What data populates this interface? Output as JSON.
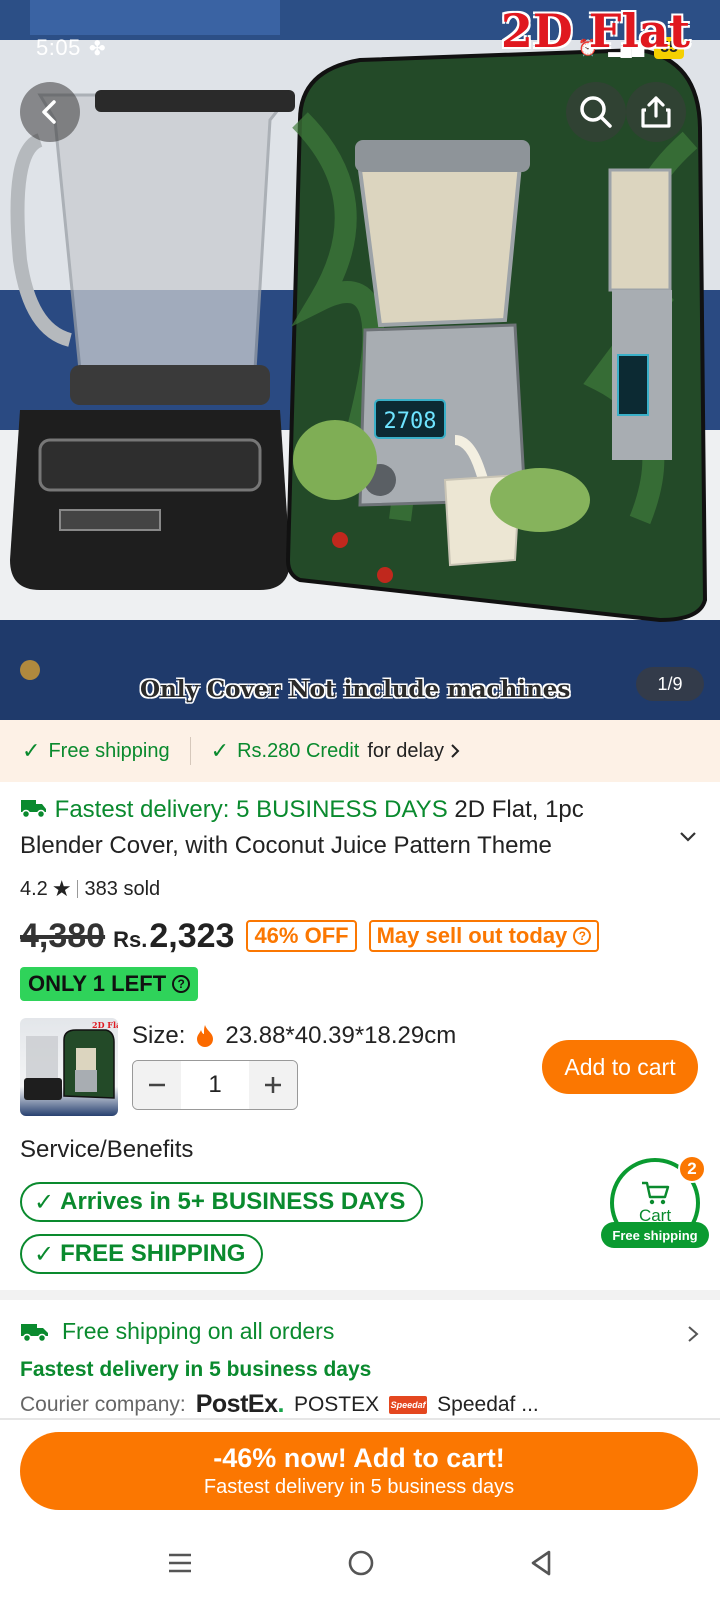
{
  "status_bar": {
    "time": "5:05",
    "battery": "55"
  },
  "hero": {
    "brand_mark": "2D Flat",
    "caption": "Only Cover Not include machines",
    "display_reading": "2708",
    "counter": "1/9"
  },
  "shipping_strip": {
    "free_shipping": "Free shipping",
    "credit_link": "Rs.280 Credit",
    "credit_suffix": "for delay"
  },
  "product": {
    "delivery_prefix": "Fastest delivery: 5 BUSINESS DAYS",
    "title": "2D Flat, 1pc Blender Cover, with Coconut Juice Pattern Theme",
    "rating": "4.2",
    "sold": "383 sold",
    "old_price": "4,380",
    "currency": "Rs.",
    "price": "2,323",
    "discount_badge": "46% OFF",
    "sellout_badge": "May sell out today",
    "stock_badge": "ONLY 1 LEFT"
  },
  "sku": {
    "size_label": "Size:",
    "size_value": "23.88*40.39*18.29cm",
    "quantity": "1",
    "add_to_cart": "Add to cart"
  },
  "service": {
    "title": "Service/Benefits",
    "benefits": [
      "Arrives in 5+ BUSINESS DAYS",
      "FREE SHIPPING"
    ]
  },
  "cart_float": {
    "label": "Cart",
    "count": "2",
    "badge": "Free shipping"
  },
  "shipping_info": {
    "headline": "Free shipping on all orders",
    "fastest": "Fastest delivery in 5 business days",
    "courier_label": "Courier company:",
    "postex_logo": "PostEx",
    "postex_name": "POSTEX",
    "speedaf_logo": "Speedaf",
    "speedaf_name": "Speedaf ..."
  },
  "cta": {
    "main": "-46% now! Add to cart!",
    "sub": "Fastest delivery in 5 business days"
  },
  "colors": {
    "accent": "#fb7701",
    "green": "#0a8a2e",
    "badge_green": "#2fd35a"
  },
  "icons": [
    "back-icon",
    "search-icon",
    "share-icon",
    "check-icon",
    "truck-icon",
    "chevron-down-icon",
    "star-icon",
    "question-icon",
    "fire-icon",
    "minus-icon",
    "plus-icon",
    "cart-icon",
    "chevron-right-icon",
    "menu-icon",
    "home-icon",
    "back-triangle-icon"
  ]
}
